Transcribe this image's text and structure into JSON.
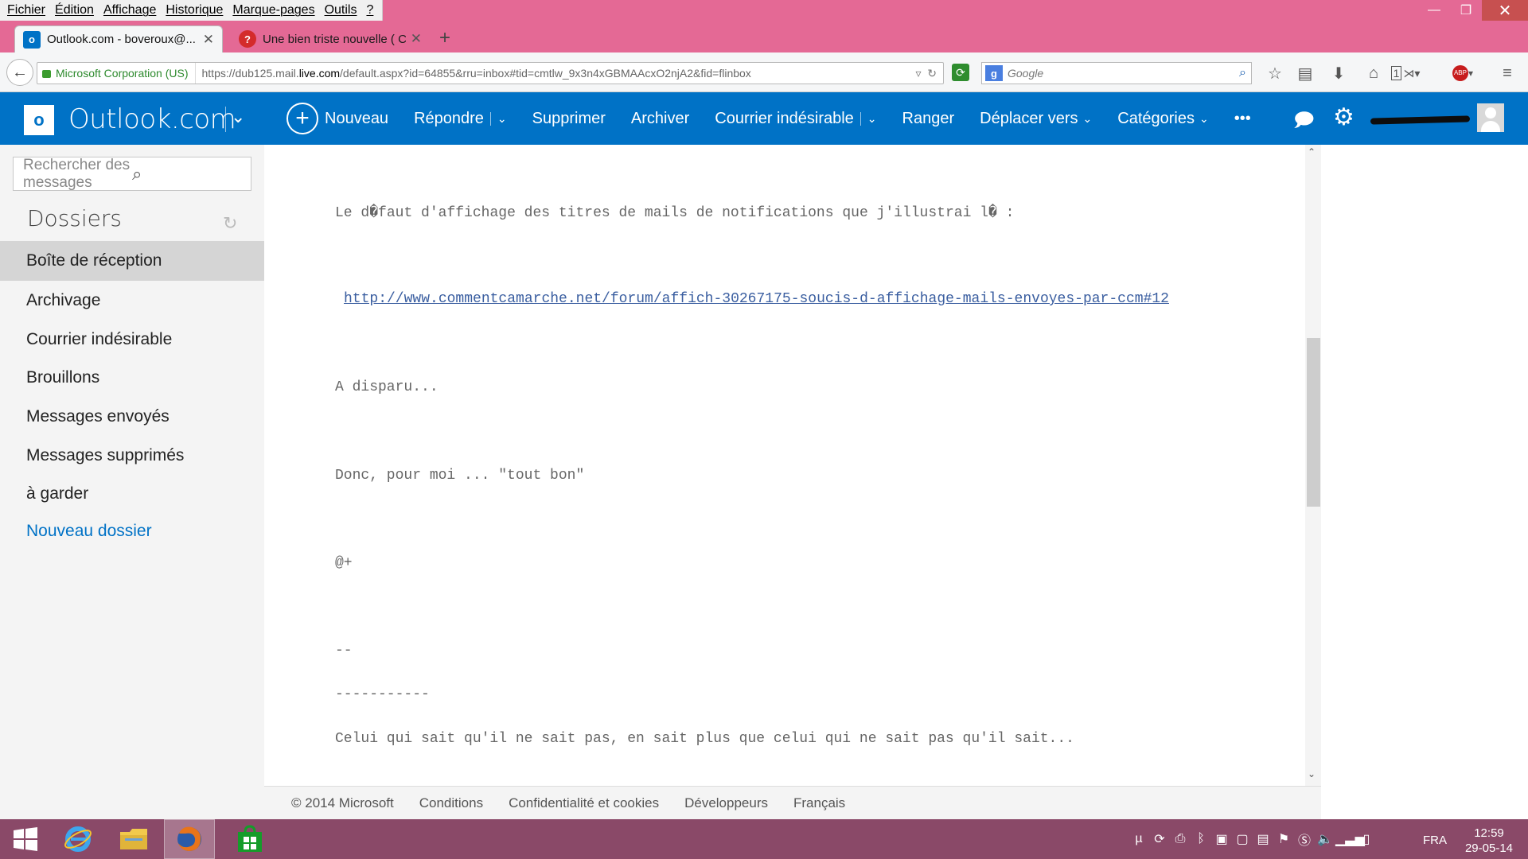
{
  "browser": {
    "menu": [
      "Fichier",
      "Édition",
      "Affichage",
      "Historique",
      "Marque-pages",
      "Outils",
      "?"
    ],
    "window_controls": {
      "minimize": "—",
      "maximize": "❐",
      "close": "✕"
    },
    "tabs": [
      {
        "title": "Outlook.com - boveroux@...",
        "icon": "outlook-icon",
        "active": true
      },
      {
        "title": "Une bien triste nouvelle ( C...",
        "icon": "help-icon",
        "active": false
      }
    ],
    "url_identity": "Microsoft Corporation (US)",
    "url_prefix": "https://dub125.mail.",
    "url_domain": "live.com",
    "url_suffix": "/default.aspx?id=64855&rru=inbox#tid=cmtlw_9x3n4xGBMAAcxO2njA2&fid=flinbox",
    "search_placeholder": "Google",
    "toolbar_badge": "1"
  },
  "app": {
    "brand": "Outlook.com",
    "toolbar": {
      "new": "Nouveau",
      "reply": "Répondre",
      "delete": "Supprimer",
      "archive": "Archiver",
      "junk": "Courrier indésirable",
      "sweep": "Ranger",
      "move_to": "Déplacer vers",
      "categories": "Catégories",
      "more": "•••"
    }
  },
  "sidebar": {
    "search_placeholder": "Rechercher des messages",
    "title": "Dossiers",
    "folders": [
      {
        "label": "Boîte de réception",
        "active": true
      },
      {
        "label": "Archivage"
      },
      {
        "label": "Courrier indésirable"
      },
      {
        "label": "Brouillons"
      },
      {
        "label": "Messages envoyés"
      },
      {
        "label": "Messages supprimés"
      },
      {
        "label": "à garder"
      }
    ],
    "new_folder": "Nouveau dossier"
  },
  "message": {
    "line1": "Le d�faut d'affichage des titres de mails de notifications que j'illustrai l� :",
    "link": "http://www.commentcamarche.net/forum/affich-30267175-soucis-d-affichage-mails-envoyes-par-ccm#12",
    "line2": "A disparu...",
    "line3": "Donc, pour moi ... \"tout bon\"",
    "line4": "@+",
    "sig_sep": "--",
    "sig_rule": "-----------",
    "sig_quote": "Celui qui sait qu'il ne sait pas, en sait plus que celui qui ne sait pas qu'il sait..."
  },
  "footer": {
    "copyright": "© 2014 Microsoft",
    "terms": "Conditions",
    "privacy": "Confidentialité et cookies",
    "developers": "Développeurs",
    "language": "Français"
  },
  "taskbar": {
    "lang": "FRA",
    "time": "12:59",
    "date": "29-05-14"
  },
  "colors": {
    "outlook_blue": "#0072c6",
    "titlebar_pink": "#e46995",
    "taskbar": "#8a4968"
  }
}
